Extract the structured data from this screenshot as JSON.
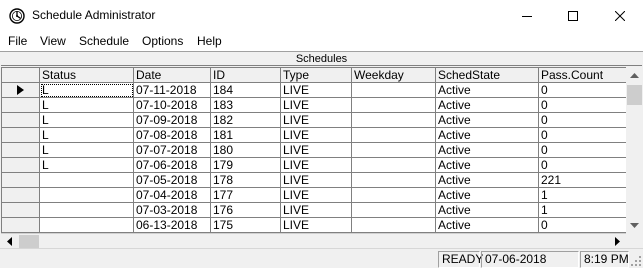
{
  "window": {
    "title": "Schedule Administrator",
    "icon": "clock-icon"
  },
  "menu": [
    "File",
    "View",
    "Schedule",
    "Options",
    "Help"
  ],
  "grid": {
    "caption": "Schedules",
    "columns": [
      "Status",
      "Date",
      "ID",
      "Type",
      "Weekday",
      "SchedState",
      "Pass.Count"
    ],
    "current_row": 0,
    "rows": [
      [
        "L",
        "07-11-2018",
        "184",
        "LIVE",
        "",
        "Active",
        "0"
      ],
      [
        "L",
        "07-10-2018",
        "183",
        "LIVE",
        "",
        "Active",
        "0"
      ],
      [
        "L",
        "07-09-2018",
        "182",
        "LIVE",
        "",
        "Active",
        "0"
      ],
      [
        "L",
        "07-08-2018",
        "181",
        "LIVE",
        "",
        "Active",
        "0"
      ],
      [
        "L",
        "07-07-2018",
        "180",
        "LIVE",
        "",
        "Active",
        "0"
      ],
      [
        "L",
        "07-06-2018",
        "179",
        "LIVE",
        "",
        "Active",
        "0"
      ],
      [
        "",
        "07-05-2018",
        "178",
        "LIVE",
        "",
        "Active",
        "221"
      ],
      [
        "",
        "07-04-2018",
        "177",
        "LIVE",
        "",
        "Active",
        "1"
      ],
      [
        "",
        "07-03-2018",
        "176",
        "LIVE",
        "",
        "Active",
        "1"
      ],
      [
        "",
        "06-13-2018",
        "175",
        "LIVE",
        "",
        "Active",
        "0"
      ]
    ]
  },
  "status": {
    "state": "READY",
    "date": "07-06-2018",
    "time": "8:19 PM"
  }
}
